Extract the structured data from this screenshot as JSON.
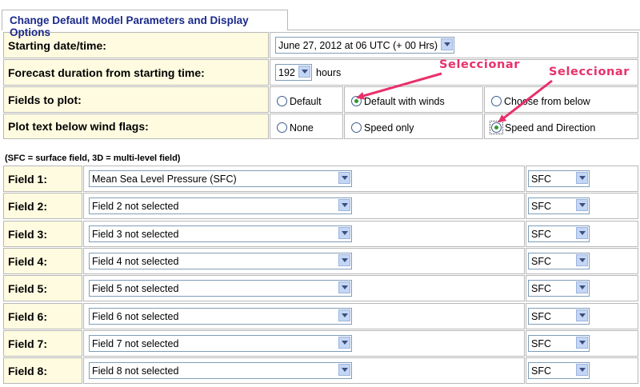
{
  "tab_title": "Change Default Model Parameters and Display Options",
  "params": {
    "start_label": "Starting date/time:",
    "start_value": "June 27, 2012 at 06 UTC (+ 00 Hrs)",
    "duration_label": "Forecast duration from starting time:",
    "duration_value": "192",
    "duration_unit": "hours",
    "fields_label": "Fields to plot:",
    "fields_options": [
      "Default",
      "Default with winds",
      "Choose from below"
    ],
    "fields_selected": "Default with winds",
    "text_label": "Plot text below wind flags:",
    "text_options": [
      "None",
      "Speed only",
      "Speed and Direction"
    ],
    "text_selected": "Speed and Direction"
  },
  "note": "(SFC = surface field, 3D = multi-level field)",
  "fields": [
    {
      "label": "Field 1:",
      "value": "Mean Sea Level Pressure (SFC)",
      "level": "SFC"
    },
    {
      "label": "Field 2:",
      "value": "Field 2 not selected",
      "level": "SFC"
    },
    {
      "label": "Field 3:",
      "value": "Field 3 not selected",
      "level": "SFC"
    },
    {
      "label": "Field 4:",
      "value": "Field 4 not selected",
      "level": "SFC"
    },
    {
      "label": "Field 5:",
      "value": "Field 5 not selected",
      "level": "SFC"
    },
    {
      "label": "Field 6:",
      "value": "Field 6 not selected",
      "level": "SFC"
    },
    {
      "label": "Field 7:",
      "value": "Field 7 not selected",
      "level": "SFC"
    },
    {
      "label": "Field 8:",
      "value": "Field 8 not selected",
      "level": "SFC"
    }
  ],
  "annotations": [
    "Seleccionar",
    "Seleccionar"
  ],
  "colors": {
    "label_bg": "#fffbe0",
    "tab_text": "#1a2a8a",
    "annotation": "#e8306a",
    "radio_dot": "#2e9a2e"
  }
}
